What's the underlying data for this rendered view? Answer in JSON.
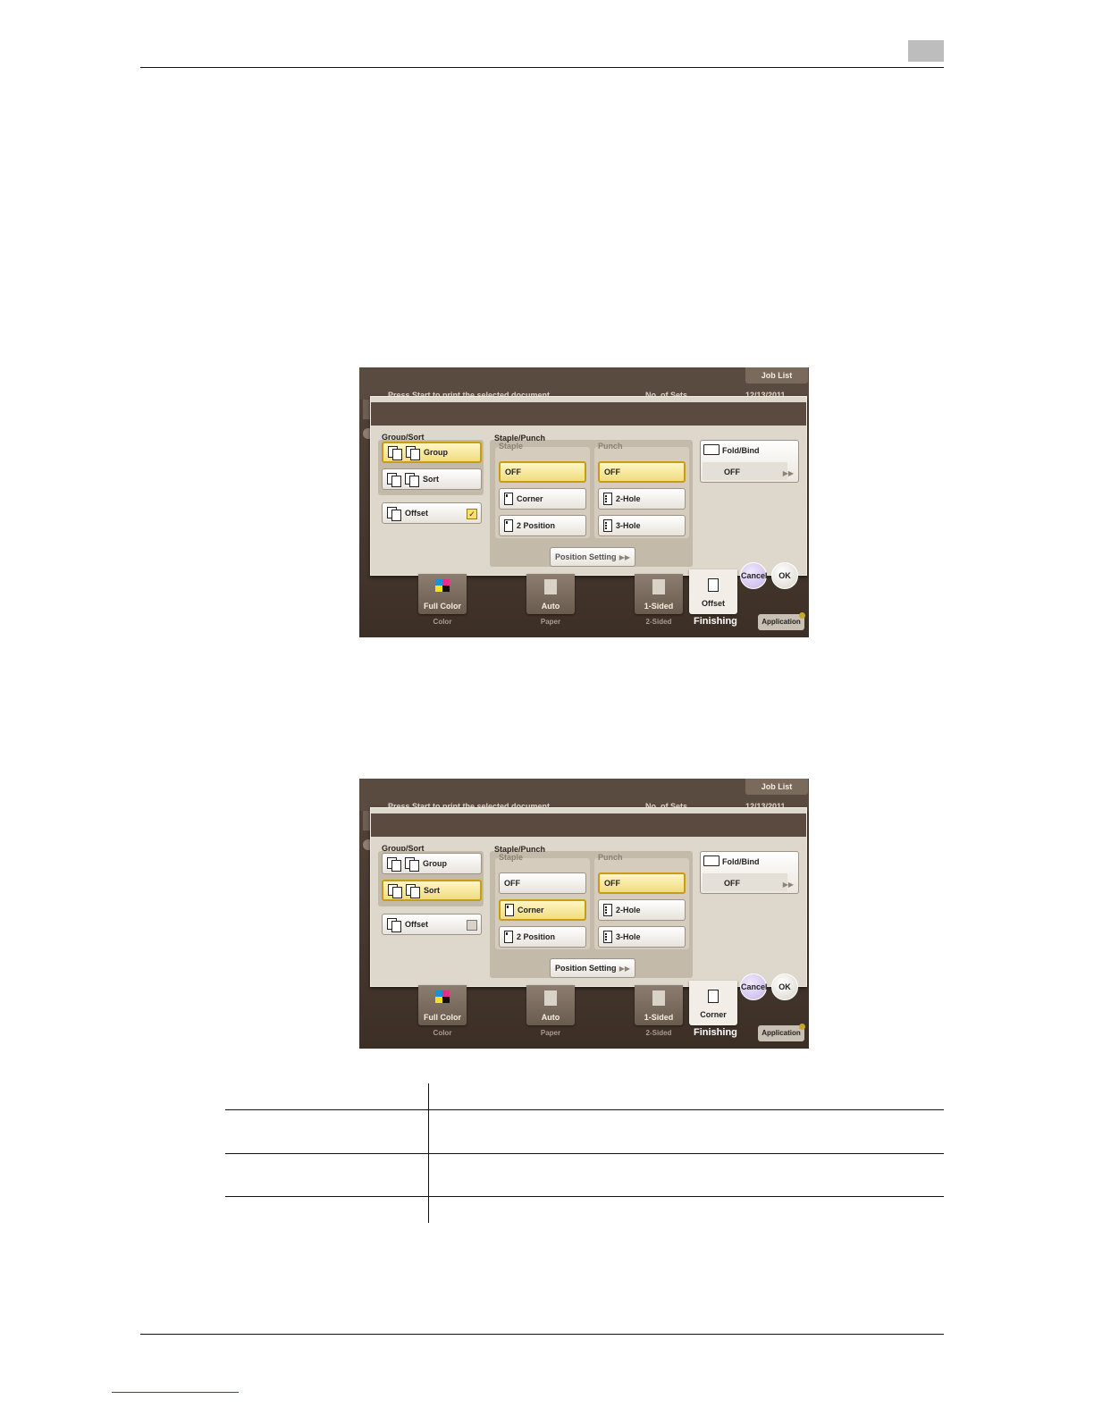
{
  "screens": [
    {
      "status_message": "Press Start to print the selected document.",
      "sets_label": "No. of Sets",
      "time": "12/13/2011",
      "job_list": "Job List",
      "group_sort_title": "Group/Sort",
      "group_label": "Group",
      "sort_label": "Sort",
      "offset_label": "Offset",
      "offset_checked": true,
      "staple_punch_title": "Staple/Punch",
      "staple_title": "Staple",
      "punch_title": "Punch",
      "staple_off": "OFF",
      "staple_corner": "Corner",
      "staple_2pos": "2 Position",
      "punch_off": "OFF",
      "punch_2hole": "2-Hole",
      "punch_3hole": "3-Hole",
      "position_setting": "Position Setting",
      "fold_bind_title": "Fold/Bind",
      "fold_bind_value": "OFF",
      "cancel": "Cancel",
      "ok": "OK",
      "tile_color": "Full Color",
      "cap_color": "Color",
      "tile_paper": "Auto",
      "cap_paper": "Paper",
      "tile_sided": "1-Sided",
      "cap_sided": "2-Sided",
      "tile_finishing": "Offset",
      "finishing_label": "Finishing",
      "application": "Application"
    },
    {
      "status_message": "Press Start to print the selected document.",
      "sets_label": "No. of Sets",
      "time": "12/13/2011",
      "job_list": "Job List",
      "group_sort_title": "Group/Sort",
      "group_label": "Group",
      "sort_label": "Sort",
      "offset_label": "Offset",
      "offset_checked": false,
      "staple_punch_title": "Staple/Punch",
      "staple_title": "Staple",
      "punch_title": "Punch",
      "staple_off": "OFF",
      "staple_corner": "Corner",
      "staple_2pos": "2 Position",
      "punch_off": "OFF",
      "punch_2hole": "2-Hole",
      "punch_3hole": "3-Hole",
      "position_setting": "Position Setting",
      "fold_bind_title": "Fold/Bind",
      "fold_bind_value": "OFF",
      "cancel": "Cancel",
      "ok": "OK",
      "tile_color": "Full Color",
      "cap_color": "Color",
      "tile_paper": "Auto",
      "cap_paper": "Paper",
      "tile_sided": "1-Sided",
      "cap_sided": "2-Sided",
      "tile_finishing": "Corner",
      "finishing_label": "Finishing",
      "application": "Application"
    }
  ],
  "colors": {
    "selected_fill": "#f0dc80",
    "selected_border": "#c99c14",
    "panel_bg": "#ded7cb",
    "screen_bg": "#3c2f26"
  }
}
